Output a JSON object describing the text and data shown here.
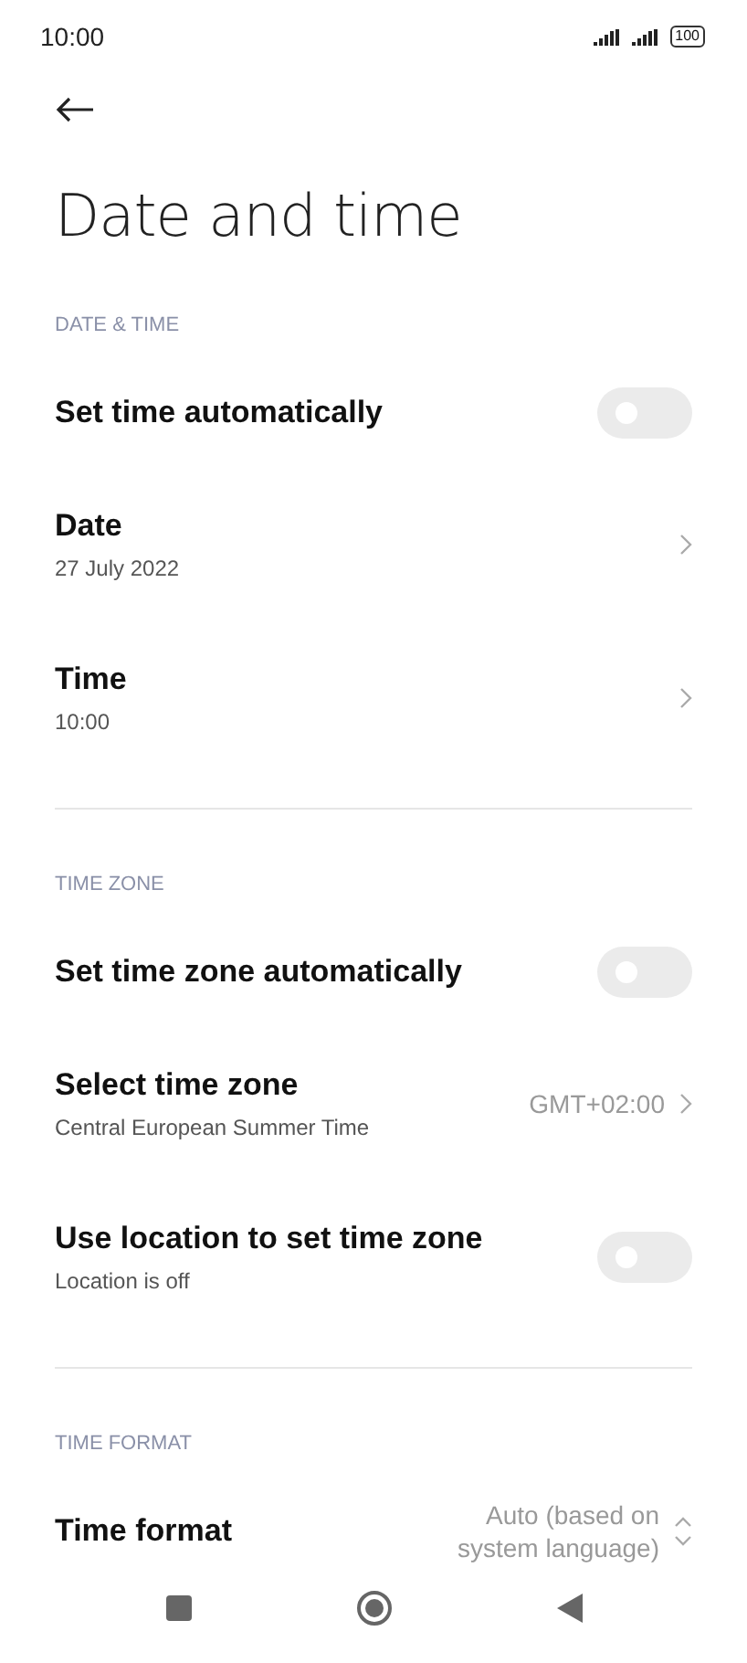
{
  "status_bar": {
    "time": "10:00",
    "battery": "100"
  },
  "title": "Date and time",
  "sections": [
    {
      "header": "DATE & TIME",
      "items": [
        {
          "kind": "toggle",
          "label": "Set time automatically",
          "on": false
        },
        {
          "kind": "link",
          "label": "Date",
          "subtitle": "27 July 2022"
        },
        {
          "kind": "link",
          "label": "Time",
          "subtitle": "10:00"
        }
      ]
    },
    {
      "header": "TIME ZONE",
      "items": [
        {
          "kind": "toggle",
          "label": "Set time zone automatically",
          "on": false
        },
        {
          "kind": "link",
          "label": "Select time zone",
          "subtitle": "Central European Summer Time",
          "value": "GMT+02:00"
        },
        {
          "kind": "toggle",
          "label": "Use location to set time zone",
          "subtitle": "Location is off",
          "on": false
        }
      ]
    },
    {
      "header": "TIME FORMAT",
      "items": [
        {
          "kind": "select",
          "label": "Time format",
          "value": "Auto (based on system language)"
        }
      ]
    }
  ]
}
